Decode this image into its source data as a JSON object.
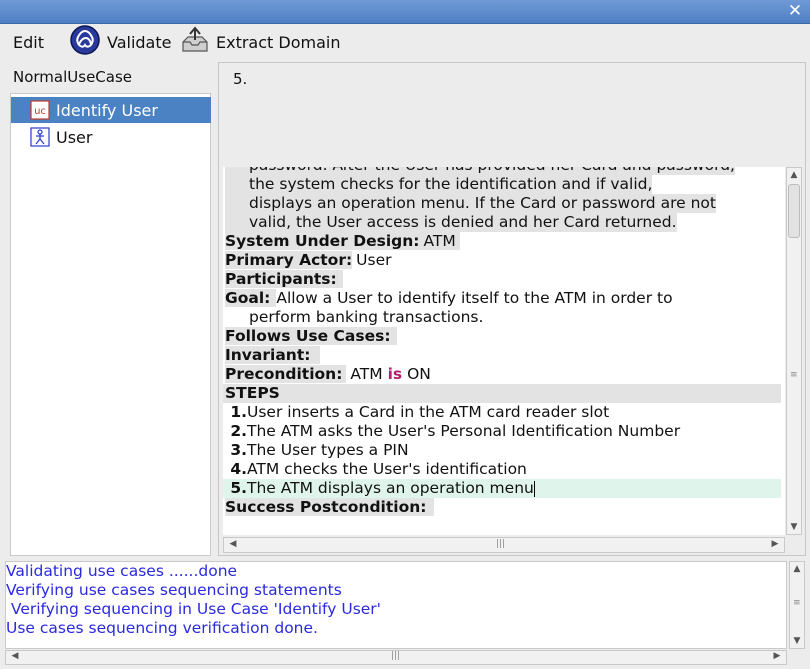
{
  "window": {
    "close_icon": "close-icon"
  },
  "menu": {
    "edit_label": "Edit",
    "validate_label": "Validate",
    "extract_label": "Extract Domain"
  },
  "tree": {
    "root": "NormalUseCase",
    "items": [
      {
        "label": "Identify User",
        "icon": "use-case-icon",
        "selected": true
      },
      {
        "label": "User",
        "icon": "actor-icon",
        "selected": false
      }
    ]
  },
  "header": {
    "number": "5."
  },
  "editor": {
    "desc_lines": [
      "password. After the User has provided her Card and password,",
      "the system checks for the identification and if valid,",
      "displays an operation menu. If the Card or password are not",
      "valid, the User access is denied and her Card returned."
    ],
    "sud_label": "System Under Design:",
    "sud_value": "ATM",
    "primary_actor_label": "Primary Actor:",
    "primary_actor_value": "User",
    "participants_label": "Participants:",
    "goal_label": "Goal:",
    "goal_line1": "Allow a User to identify itself to the ATM in order to",
    "goal_line2": "perform banking transactions.",
    "follows_label": "Follows Use Cases:",
    "invariant_label": "Invariant:",
    "precondition_label": "Precondition:",
    "precondition_pre": "ATM",
    "precondition_kw": "is",
    "precondition_post": "ON",
    "steps_label": "STEPS",
    "steps": [
      {
        "num": "1.",
        "text": "User inserts a Card in the ATM card reader slot"
      },
      {
        "num": "2.",
        "text": "The ATM asks the User's Personal Identification Number"
      },
      {
        "num": "3.",
        "text": "The User types a PIN"
      },
      {
        "num": "4.",
        "text": "ATM checks the User's identification"
      },
      {
        "num": "5.",
        "text": "The ATM displays an operation menu"
      }
    ],
    "success_label": "Success Postcondition:"
  },
  "console": {
    "lines": [
      "Validating use cases ......done",
      "Verifying use cases sequencing statements",
      " Verifying sequencing in Use Case 'Identify User'",
      "Use cases sequencing verification done."
    ]
  },
  "colors": {
    "title_bar": "#5a88c9",
    "selection": "#4a82c3",
    "console_text": "#2a2ae0",
    "keyword": "#b21e6e",
    "active_step": "#dff4ea"
  }
}
